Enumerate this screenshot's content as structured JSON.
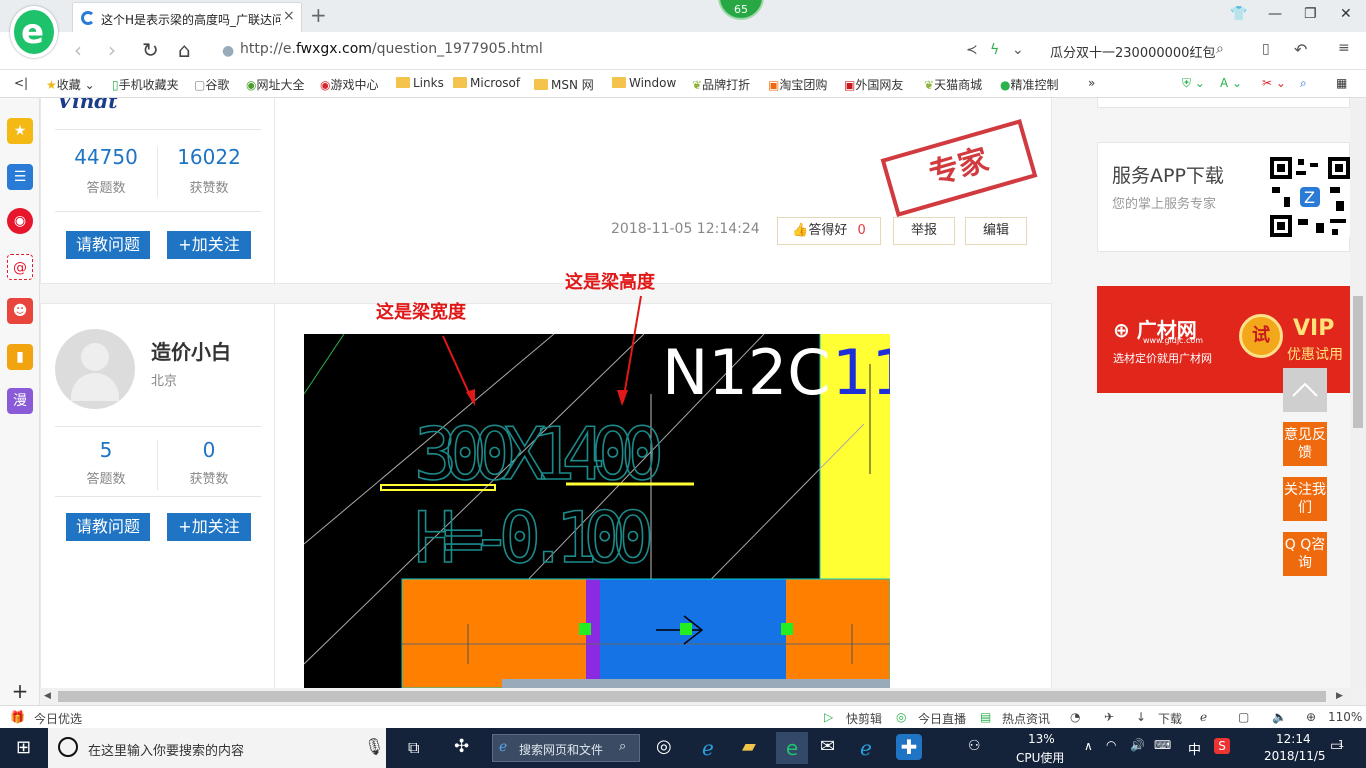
{
  "browser": {
    "tab_title": "这个H是表示梁的高度吗_广联达问答",
    "tab_close": "×",
    "new_tab": "+",
    "badge": "65",
    "url_prefix": "http://e.",
    "url_host": "fwxgx.com",
    "url_path": "/question_1977905.html",
    "search_text": "瓜分双十一230000000红包",
    "win_min": "—",
    "win_max": "❐",
    "win_close": "✕"
  },
  "bookmarks": [
    "收藏",
    "手机收藏夹",
    "谷歌",
    "网址大全",
    "游戏中心",
    "Links",
    "Microsof",
    "MSN 网",
    "Window",
    "品牌打折",
    "淘宝团购",
    "外国网友",
    "天猫商城",
    "精准控制"
  ],
  "answers": [
    {
      "logo_text": "Vindt",
      "stats": [
        {
          "value": "44750",
          "label": "答题数"
        },
        {
          "value": "16022",
          "label": "获赞数"
        }
      ],
      "ask_btn": "请教问题",
      "follow_btn": "+加关注",
      "timestamp": "2018-11-05 12:14:24",
      "like_label": "答得好",
      "like_count": "0",
      "report": "举报",
      "edit": "编辑",
      "stamp": "专家"
    },
    {
      "name": "造价小白",
      "location": "北京",
      "stats": [
        {
          "value": "5",
          "label": "答题数"
        },
        {
          "value": "0",
          "label": "获赞数"
        }
      ],
      "ask_btn": "请教问题",
      "follow_btn": "+加关注",
      "annotation_width": "这是梁宽度",
      "annotation_height": "这是梁高度",
      "cad_label": "300X1400",
      "cad_elev": "H=-0.100",
      "cad_grid": "N12C",
      "cad_grid2": "11"
    }
  ],
  "right": {
    "app_title": "服务APP下载",
    "app_sub": "您的掌上服务专家",
    "ad_logo": "广材网",
    "ad_url": "www.gldjc.com",
    "ad_slogan": "选材定价就用广材网",
    "ad_try": "试",
    "ad_vip": "VIP",
    "ad_vip2": "优惠试用",
    "float_buttons": [
      "意见反馈",
      "关注我们",
      "Q Q咨询"
    ]
  },
  "status_bar": {
    "left": "今日优选",
    "items": [
      "快剪辑",
      "今日直播",
      "热点资讯",
      "下载"
    ],
    "zoom": "110%"
  },
  "taskbar": {
    "search_placeholder": "在这里输入你要搜索的内容",
    "search2": "搜索网页和文件",
    "cpu": "13%",
    "cpu_label": "CPU使用",
    "ime": "中",
    "time": "12:14",
    "date": "2018/11/5",
    "notif": "1"
  }
}
